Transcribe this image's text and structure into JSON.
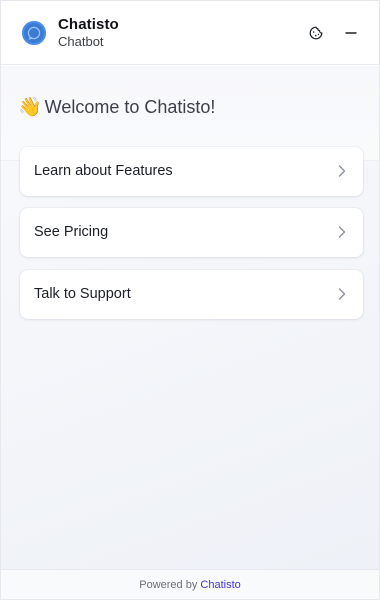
{
  "header": {
    "title": "Chatisto",
    "subtitle": "Chatbot",
    "avatar_icon": "chat-bubble-icon",
    "cookie_icon": "cookie-icon",
    "minimize_icon": "minus-icon"
  },
  "welcome": {
    "emoji": "👋",
    "text": "Welcome to Chatisto!"
  },
  "options": [
    {
      "label": "Learn about Features"
    },
    {
      "label": "See Pricing"
    },
    {
      "label": "Talk to Support"
    }
  ],
  "footer": {
    "prefix": "Powered by",
    "brand": "Chatisto"
  },
  "colors": {
    "accent": "#3a7bd5",
    "brand_link": "#4338ca"
  }
}
